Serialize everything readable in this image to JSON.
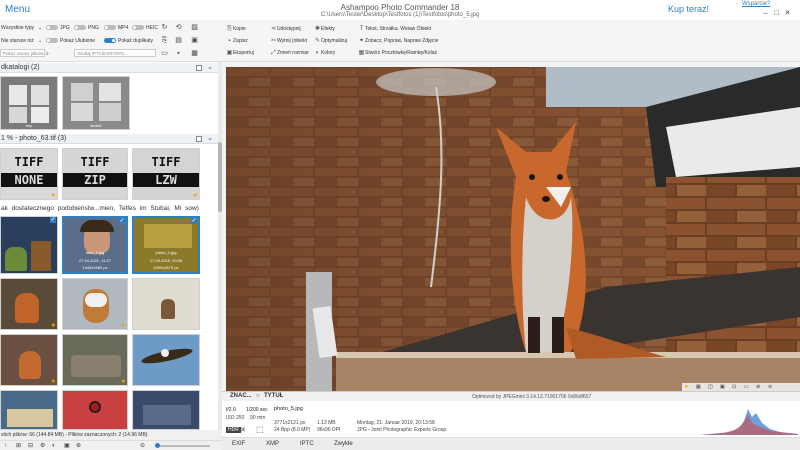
{
  "header": {
    "menu_label": "Menu",
    "app_title": "Ashampoo Photo Commander 18",
    "file_path": "C:\\Users\\Tester\\Desktop\\Testfotos (1)\\Testfotos\\photo_5.jpg",
    "buy_label": "Kup teraz!",
    "support_label": "Wsparcie?",
    "window_controls": [
      "–",
      "□",
      "✕"
    ]
  },
  "left_toolbar": {
    "row1": {
      "label": "Wszystkie typy",
      "chk1": "JPG",
      "chk2": "PNG",
      "chk3": "MP4",
      "chk4": "HEIC"
    },
    "row2": {
      "label": "Nie starsze niż",
      "toggle1": "Pokaż Ulubione",
      "toggle2": "Pokaż duplikaty"
    },
    "row3": {
      "input1": "Pokaż nazwy plików...",
      "input2": "Szukaj IPTC/EXIF/GPS..."
    }
  },
  "left_panel": {
    "group1": {
      "title": "dkatalogi",
      "count": "(2)",
      "items": [
        {
          "caption": "tmp"
        },
        {
          "caption": "similar"
        }
      ]
    },
    "group2": {
      "title": "1 % - photo_63.tif",
      "count": "(3)",
      "items": [
        {
          "line1": "TIFF",
          "line2": "NONE"
        },
        {
          "line1": "TIFF",
          "line2": "ZIP"
        },
        {
          "line1": "TIFF",
          "line2": "LZW"
        }
      ]
    },
    "group3": {
      "title": "ak dostatecznego podobieństw...mien, Telfes im Stubai, Mi",
      "suffix": "sow)",
      "sel1": {
        "name": "face_1.jpg",
        "date": "27.04.2021, 11:27",
        "size": "1440x1960 px"
      },
      "sel2": {
        "name": "photo_1.jpg",
        "date": "17.09.2019, 20:08",
        "size": "4000x2670 px"
      }
    }
  },
  "status": {
    "left_text": "stich plików: 66 (144.84 MB) - Plików zaznaczonych: 2 (14.96 MB)",
    "bottom_icons": [
      "↑",
      "⊞",
      "⊟",
      "⚙",
      "◐",
      "▣",
      "⊕",
      "⊖"
    ]
  },
  "right_toolbar": {
    "col1": [
      "Kopie",
      "Zapisz",
      "Eksportuj"
    ],
    "col2": [
      "Udostępnij",
      "Wytnij (obiekt",
      "Zmień rozmiar"
    ],
    "col3": [
      "Efekty",
      "Optymalizuj",
      "Kolory"
    ],
    "col4": [
      "Tekst, Strzałka, Wstaw Obiekt",
      "Zobacz, Popraw, Napraw Zdjęcie",
      "Stwórz Pocztówkę/Ramkę/Kolaż"
    ]
  },
  "viewer": {
    "tab1": "ZNAC...",
    "tab2": "TYTUŁ",
    "optimized_text": "Optimized by JPEGmini 3.14.12.71901706 0x86df657"
  },
  "info": {
    "aperture": "f/2.0",
    "shutter": "1/200 sec",
    "iso": "ISO 250",
    "focal": "90 mm",
    "filename": "photo_5.jpg",
    "dimensions": "3771x2121 px",
    "depth": "24 Bpp (8.0 MP)",
    "filesize": "1.13 MB",
    "dpi": "96x96 DPI",
    "date": "Montag, 21. Januar 2019, 20:13:58",
    "format": "JPG - Joint Photographic Experts Group",
    "hdr_badge": "HDR"
  },
  "meta_tabs": [
    "EXIF",
    "XMP",
    "IPTC",
    "Zwykłe"
  ],
  "colors": {
    "accent": "#2f7fc1",
    "star": "#f0a800"
  }
}
